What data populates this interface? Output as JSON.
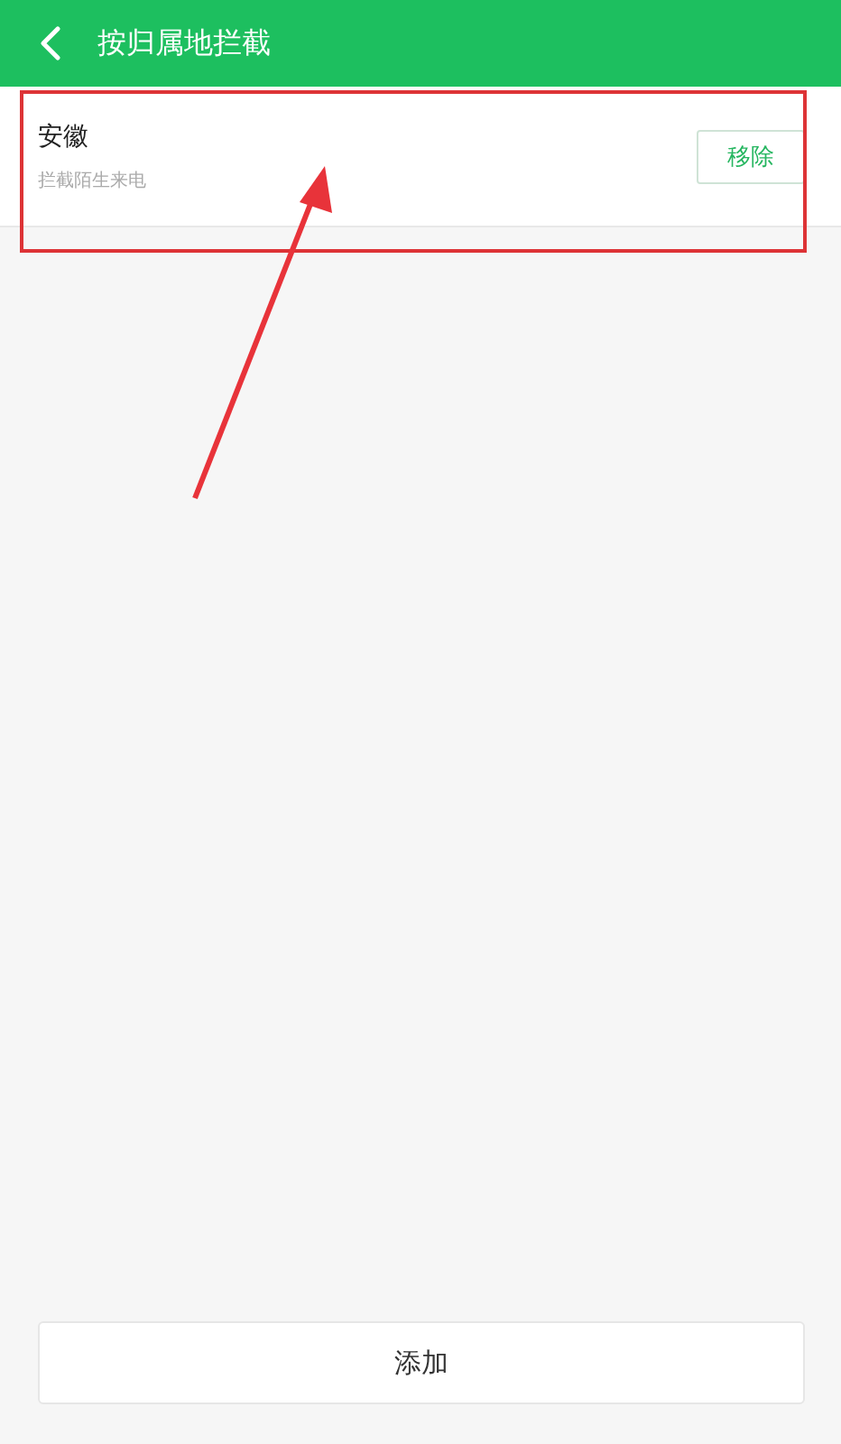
{
  "header": {
    "title": "按归属地拦截"
  },
  "items": [
    {
      "title": "安徽",
      "subtitle": "拦截陌生来电",
      "action": "移除"
    }
  ],
  "add_button": "添加"
}
